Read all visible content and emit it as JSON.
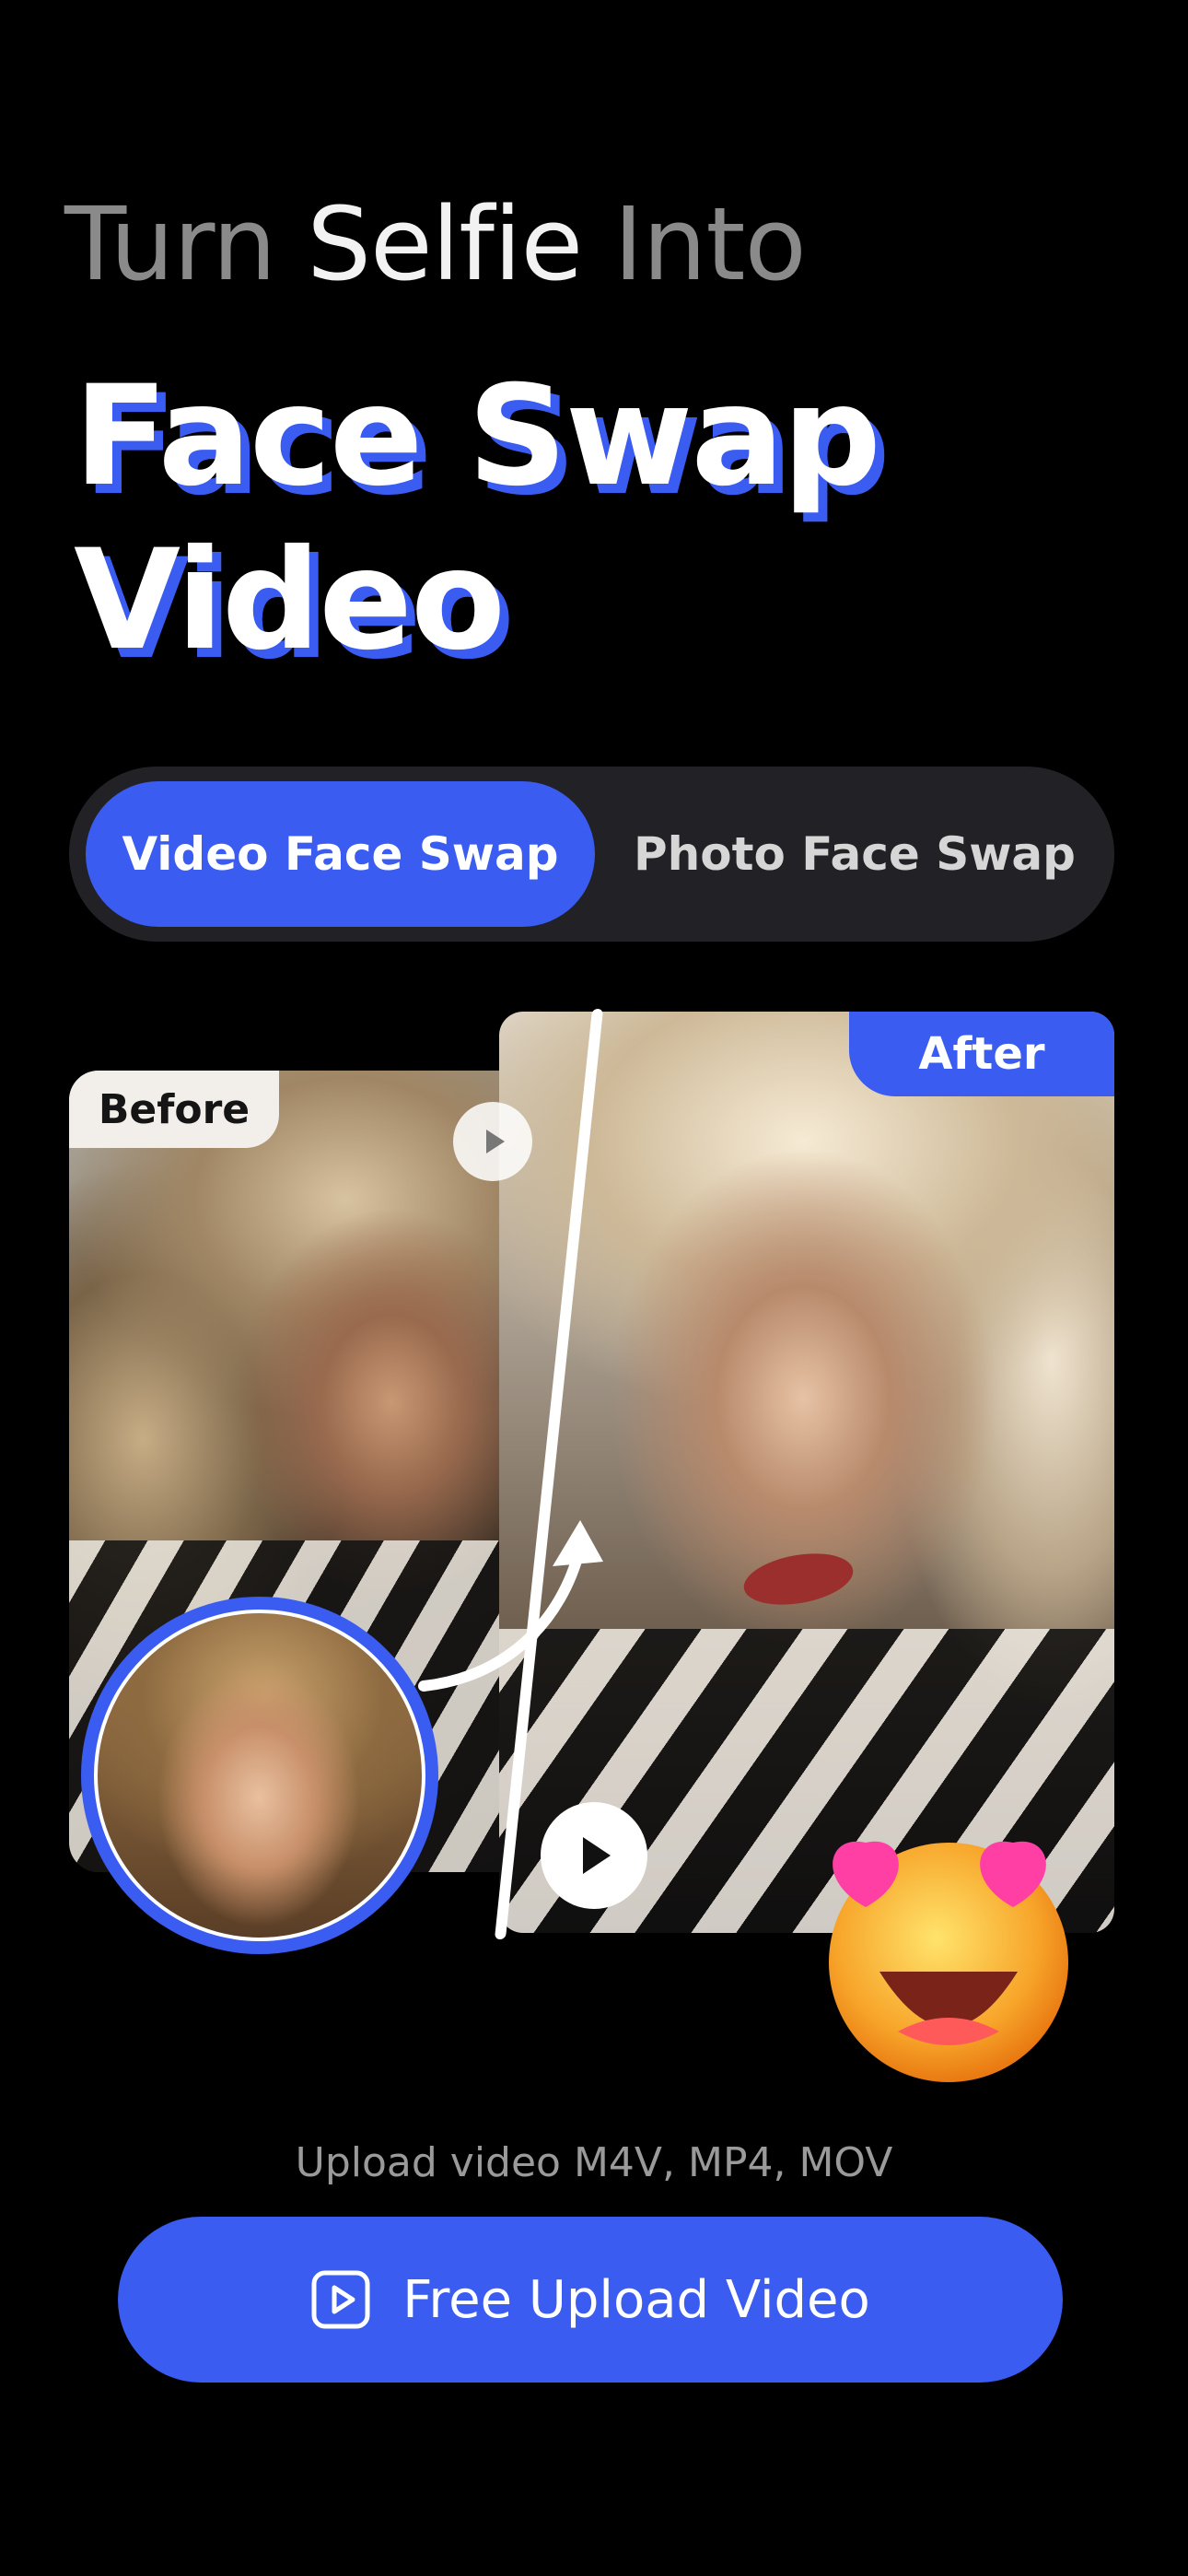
{
  "header": {
    "pre_title_part1": "Turn ",
    "pre_title_part2": "Selfie",
    "pre_title_part3": " Into",
    "title_line1": "Face Swap",
    "title_line2": "Video"
  },
  "tabs": [
    {
      "label": "Video Face Swap",
      "active": true
    },
    {
      "label": "Photo Face Swap",
      "active": false
    }
  ],
  "preview": {
    "before_label": "Before",
    "after_label": "After"
  },
  "upload": {
    "hint": "Upload video M4V, MP4, MOV",
    "button_label": "Free Upload Video"
  },
  "colors": {
    "accent": "#3a5cf0",
    "background": "#000000",
    "segment_bg": "#222226"
  },
  "icons": {
    "play": "play-icon",
    "upload": "video-upload-icon",
    "emoji": "heart-eyes-emoji"
  }
}
